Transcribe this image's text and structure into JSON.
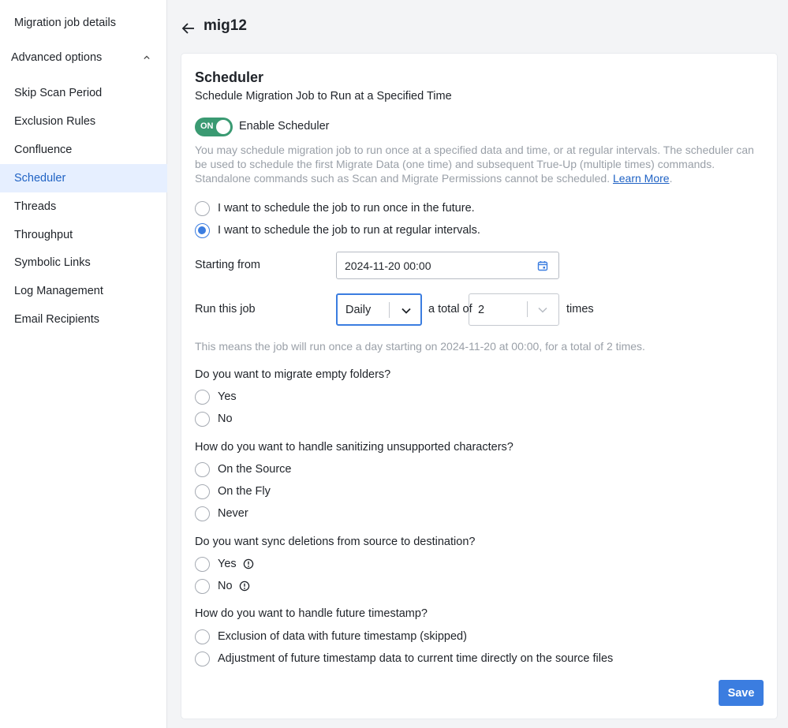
{
  "sidebar": {
    "items": [
      {
        "label": "Migration job details"
      },
      {
        "label": "Advanced options"
      },
      {
        "label": "Skip Scan Period"
      },
      {
        "label": "Exclusion Rules"
      },
      {
        "label": "Confluence"
      },
      {
        "label": "Scheduler",
        "active": true
      },
      {
        "label": "Threads"
      },
      {
        "label": "Throughput"
      },
      {
        "label": "Symbolic Links"
      },
      {
        "label": "Log Management"
      },
      {
        "label": "Email Recipients"
      }
    ]
  },
  "header": {
    "title": "mig12",
    "back_icon": "arrow-left-icon"
  },
  "scheduler": {
    "title": "Scheduler",
    "subtitle": "Schedule Migration Job to Run at a Specified Time",
    "toggle_state": "ON",
    "toggle_label": "Enable Scheduler",
    "description": "You may schedule migration job to run once at a specified data and time, or at regular intervals. The scheduler can be used to schedule the first Migrate Data (one time) and subsequent True-Up (multiple times) commands. Standalone commands such as Scan and Migrate Permissions cannot be scheduled.",
    "learn_more": "Learn More",
    "schedule_options": [
      {
        "label": "I want to schedule the job to run once in the future.",
        "checked": false
      },
      {
        "label": "I want to schedule the job to run at regular intervals.",
        "checked": true
      }
    ],
    "starting_from_label": "Starting from",
    "starting_from_value": "2024-11-20 00:00",
    "run_job_label": "Run this job",
    "frequency_value": "Daily",
    "total_of_label": "a total of",
    "count_value": "2",
    "times_label": "times",
    "hint": "This means the job will run once a day starting on 2024-11-20 at 00:00, for a total of 2 times."
  },
  "questions": {
    "empty_folders": {
      "question": "Do you want to migrate empty folders?",
      "options": [
        "Yes",
        "No"
      ]
    },
    "sanitizing": {
      "question": "How do you want to handle sanitizing unsupported characters?",
      "options": [
        "On the Source",
        "On the Fly",
        "Never"
      ]
    },
    "sync_deletions": {
      "question": "Do you want sync deletions from source to destination?",
      "options": [
        "Yes",
        "No"
      ]
    },
    "future_timestamp": {
      "question": "How do you want to handle future timestamp?",
      "options": [
        "Exclusion of data with future timestamp (skipped)",
        "Adjustment of future timestamp data to current time directly on the source files"
      ]
    }
  },
  "actions": {
    "save_label": "Save"
  },
  "colors": {
    "accent": "#3b7de0",
    "toggle_on": "#3a9a72",
    "active_bg": "#e6efff",
    "muted_text": "#9aa0a8"
  }
}
